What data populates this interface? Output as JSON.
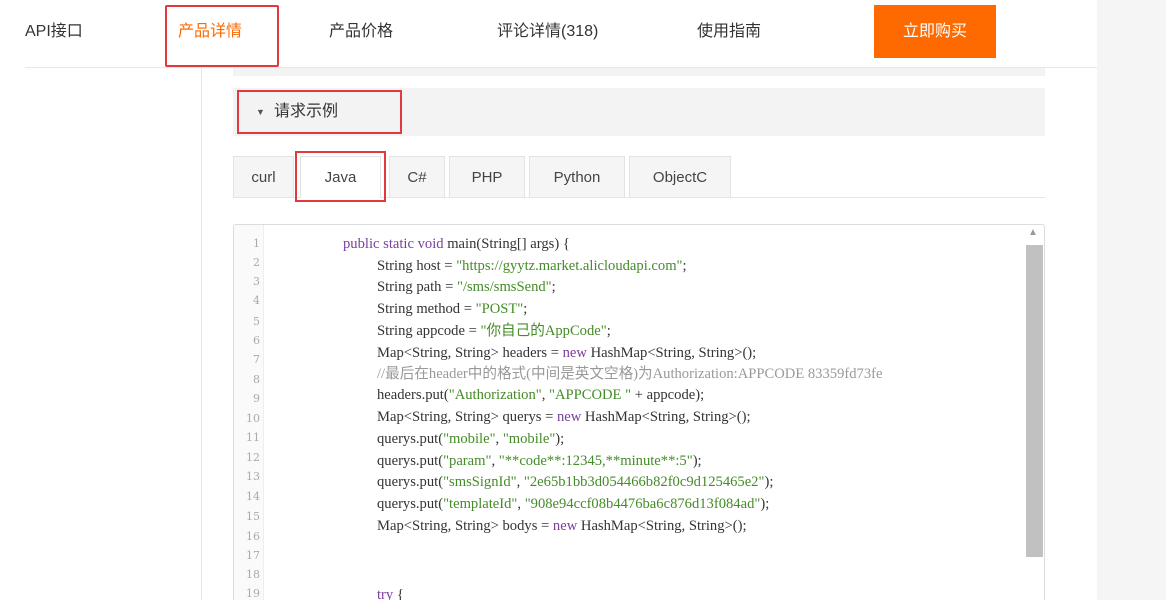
{
  "nav": {
    "items": [
      {
        "label": "API接口",
        "active": false
      },
      {
        "label": "产品详情",
        "active": true
      },
      {
        "label": "产品价格",
        "active": false
      },
      {
        "label": "评论详情(318)",
        "active": false
      },
      {
        "label": "使用指南",
        "active": false
      }
    ],
    "buy_label": "立即购买"
  },
  "section": {
    "title": "请求示例",
    "arrow_icon": "caret-down-icon"
  },
  "tabs": [
    {
      "label": "curl",
      "active": false
    },
    {
      "label": "Java",
      "active": true
    },
    {
      "label": "C#",
      "active": false
    },
    {
      "label": "PHP",
      "active": false
    },
    {
      "label": "Python",
      "active": false
    },
    {
      "label": "ObjectC",
      "active": false
    }
  ],
  "code": {
    "line_numbers": [
      "1",
      "2",
      "3",
      "4",
      "5",
      "6",
      "7",
      "8",
      "9",
      "10",
      "11",
      "12",
      "13",
      "14",
      "15",
      "16",
      "17",
      "18",
      "19"
    ],
    "lines": [
      "public static void main(String[] args) {",
      "String host = \"https://gyytz.market.alicloudapi.com\";",
      "String path = \"/sms/smsSend\";",
      "String method = \"POST\";",
      "String appcode = \"你自己的AppCode\";",
      "Map<String, String> headers = new HashMap<String, String>();",
      "//最后在header中的格式(中间是英文空格)为Authorization:APPCODE 83359fd73fe",
      "headers.put(\"Authorization\", \"APPCODE \" + appcode);",
      "Map<String, String> querys = new HashMap<String, String>();",
      "querys.put(\"mobile\", \"mobile\");",
      "querys.put(\"param\", \"**code**:12345,**minute**:5\");",
      "querys.put(\"smsSignId\", \"2e65b1bb3d054466b82f0c9d125465e2\");",
      "querys.put(\"templateId\", \"908e94ccf08b4476ba6c876d13f084ad\");",
      "Map<String, String> bodys = new HashMap<String, String>();",
      "try {"
    ]
  },
  "colors": {
    "accent": "#ff6a00",
    "highlight_box": "#e4393c",
    "keyword": "#7a3e9d",
    "string": "#448c27",
    "comment": "#999999"
  }
}
